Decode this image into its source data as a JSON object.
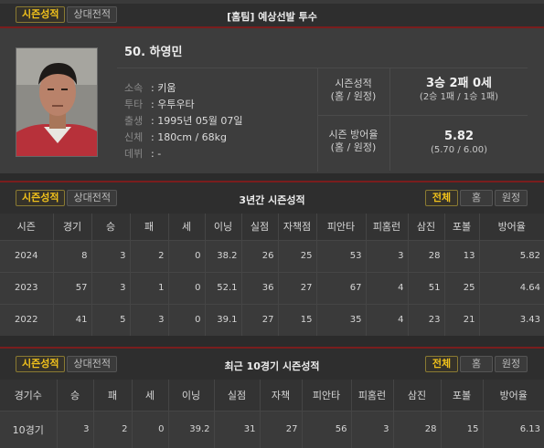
{
  "top": {
    "tabs": [
      "시즌성적",
      "상대전적"
    ],
    "title": "[홈팀] 예상선발 투수"
  },
  "profile": {
    "name": "50. 하영민",
    "info": [
      {
        "k": "소속",
        "v": ": 키움"
      },
      {
        "k": "투타",
        "v": ": 우투우타"
      },
      {
        "k": "출생",
        "v": ": 1995년 05월 07일"
      },
      {
        "k": "신체",
        "v": ": 180cm / 68kg"
      },
      {
        "k": "데뷔",
        "v": ": -"
      }
    ],
    "season_record": {
      "label1": "시즌성적",
      "label2": "(홈 / 원정)",
      "value": "3승 2패 0세",
      "sub": "(2승 1패 / 1승 1패)"
    },
    "season_era": {
      "label1": "시즌 방어율",
      "label2": "(홈 / 원정)",
      "value": "5.82",
      "sub": "(5.70 / 6.00)"
    }
  },
  "three_year": {
    "tabs": [
      "시즌성적",
      "상대전적"
    ],
    "title": "3년간 시즌성적",
    "filters": [
      "전체",
      "홈",
      "원정"
    ],
    "columns": [
      "시즌",
      "경기",
      "승",
      "패",
      "세",
      "이닝",
      "실점",
      "자책점",
      "피안타",
      "피홈런",
      "삼진",
      "포볼",
      "방어율"
    ],
    "rows": [
      [
        "2024",
        "8",
        "3",
        "2",
        "0",
        "38.2",
        "26",
        "25",
        "53",
        "3",
        "28",
        "13",
        "5.82"
      ],
      [
        "2023",
        "57",
        "3",
        "1",
        "0",
        "52.1",
        "36",
        "27",
        "67",
        "4",
        "51",
        "25",
        "4.64"
      ],
      [
        "2022",
        "41",
        "5",
        "3",
        "0",
        "39.1",
        "27",
        "15",
        "35",
        "4",
        "23",
        "21",
        "3.43"
      ]
    ]
  },
  "recent": {
    "tabs": [
      "시즌성적",
      "상대전적"
    ],
    "title": "최근 10경기 시즌성적",
    "filters": [
      "전체",
      "홈",
      "원정"
    ],
    "columns": [
      "경기수",
      "승",
      "패",
      "세",
      "이닝",
      "실점",
      "자책",
      "피안타",
      "피홈런",
      "삼진",
      "포볼",
      "방어율"
    ],
    "rows": [
      [
        "10경기",
        "3",
        "2",
        "0",
        "39.2",
        "31",
        "27",
        "56",
        "3",
        "28",
        "15",
        "6.13"
      ]
    ]
  }
}
